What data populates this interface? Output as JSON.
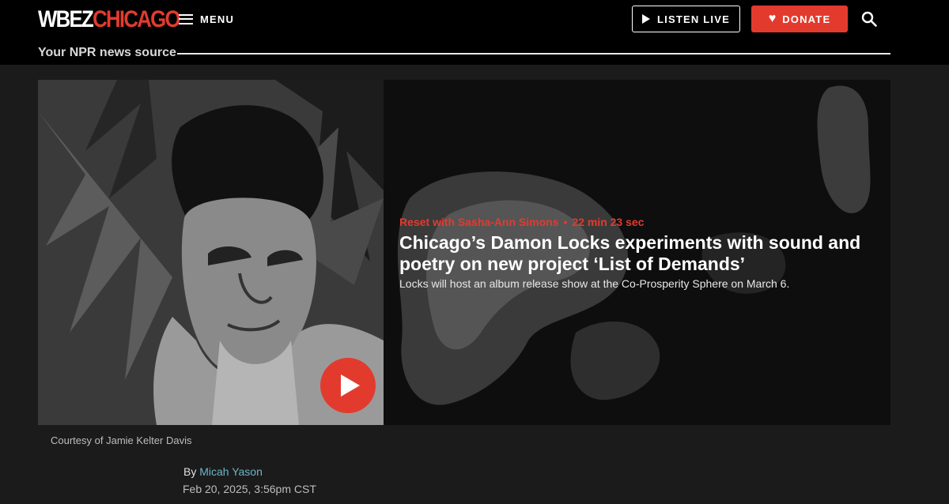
{
  "header": {
    "logo_primary": "WBEZ",
    "logo_secondary": "CHICAGO",
    "menu_label": "MENU",
    "listen_label": "LISTEN LIVE",
    "donate_label": "DONATE",
    "tagline": "Your NPR news source"
  },
  "colors": {
    "brand_red": "#e23b2e",
    "link_teal": "#6cb5c8",
    "background": "#1b1b1b"
  },
  "icons": {
    "menu": "hamburger-icon",
    "listen": "play-icon",
    "donate": "heart-icon",
    "search": "search-icon",
    "media": "play-button-icon"
  },
  "story": {
    "show": "Reset with Sasha-Ann Simons",
    "separator": "•",
    "duration": "22 min 23 sec",
    "headline": "Chicago’s Damon Locks experiments with sound and poetry on new project ‘List of Demands’",
    "dek": "Locks will host an album release show at the Co-Prosperity Sphere on March 6.",
    "photo_credit": "Courtesy of Jamie Kelter Davis",
    "byline_prefix": "By",
    "author": "Micah Yason",
    "date": "Feb 20, 2025, 3:56pm CST"
  }
}
